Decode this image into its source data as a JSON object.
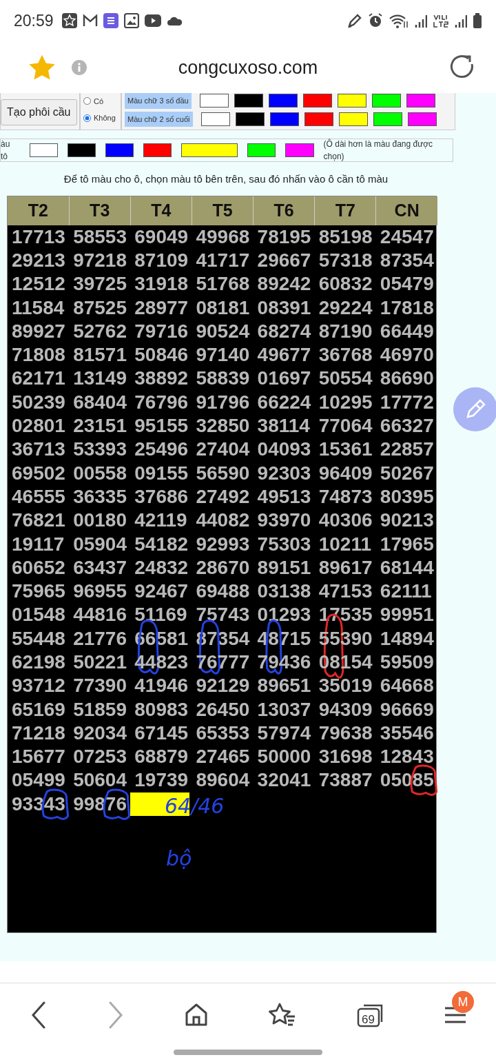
{
  "status_bar": {
    "time": "20:59"
  },
  "address_bar": {
    "url": "congcuxoso.com",
    "bookmarked": true
  },
  "options": {
    "button": "Tạo phôi cầu",
    "radios": [
      {
        "label": "Có",
        "selected": false
      },
      {
        "label": "Không",
        "selected": true
      }
    ]
  },
  "text_colors": [
    {
      "label": "Màu chữ 3 số đầu",
      "swatches": [
        {
          "color": "#ffffff"
        },
        {
          "color": "#000000"
        },
        {
          "color": "#0000ff"
        },
        {
          "color": "#ff0000"
        },
        {
          "color": "#ffff00"
        },
        {
          "color": "#00ff00"
        },
        {
          "color": "#ff00ff"
        }
      ]
    },
    {
      "label": "Màu chữ 2 số cuối",
      "swatches": [
        {
          "color": "#ffffff"
        },
        {
          "color": "#000000"
        },
        {
          "color": "#0000ff"
        },
        {
          "color": "#ff0000"
        },
        {
          "color": "#ffff00"
        },
        {
          "color": "#00ff00"
        },
        {
          "color": "#ff00ff"
        }
      ]
    }
  ],
  "fill_colors": {
    "label": "àu tô",
    "hint": "(Ô dài hơn là màu đang được chọn)",
    "swatches": [
      {
        "color": "#ffffff",
        "selected": false
      },
      {
        "color": "#000000",
        "selected": false
      },
      {
        "color": "#0000ff",
        "selected": false
      },
      {
        "color": "#ff0000",
        "selected": false
      },
      {
        "color": "#ffff00",
        "selected": true
      },
      {
        "color": "#00ff00",
        "selected": false
      },
      {
        "color": "#ff00ff",
        "selected": false
      }
    ]
  },
  "instruction": "Để tô màu cho ô, chọn màu tô bên trên, sau đó nhấn vào ô cần tô màu",
  "table": {
    "columns": [
      "T2",
      "T3",
      "T4",
      "T5",
      "T6",
      "T7",
      "CN"
    ],
    "rows": [
      [
        "17713",
        "58553",
        "69049",
        "49968",
        "78195",
        "85198",
        "24547"
      ],
      [
        "29213",
        "97218",
        "87109",
        "41717",
        "29667",
        "57318",
        "87354"
      ],
      [
        "12512",
        "39725",
        "31918",
        "51768",
        "89242",
        "60832",
        "05479"
      ],
      [
        "11584",
        "87525",
        "28977",
        "08181",
        "08391",
        "29224",
        "17818"
      ],
      [
        "89927",
        "52762",
        "79716",
        "90524",
        "68274",
        "87190",
        "66449"
      ],
      [
        "71808",
        "81571",
        "50846",
        "97140",
        "49677",
        "36768",
        "46970"
      ],
      [
        "62171",
        "13149",
        "38892",
        "58839",
        "01697",
        "50554",
        "86690"
      ],
      [
        "50239",
        "68404",
        "76796",
        "91796",
        "66224",
        "10295",
        "17772"
      ],
      [
        "02801",
        "23151",
        "95155",
        "32850",
        "38114",
        "77064",
        "66327"
      ],
      [
        "36713",
        "53393",
        "25496",
        "27404",
        "04093",
        "15361",
        "22857"
      ],
      [
        "69502",
        "00558",
        "09155",
        "56590",
        "92303",
        "96409",
        "50267"
      ],
      [
        "46555",
        "36335",
        "37686",
        "27492",
        "49513",
        "74873",
        "80395"
      ],
      [
        "76821",
        "00180",
        "42119",
        "44082",
        "93970",
        "40306",
        "90213"
      ],
      [
        "19117",
        "05904",
        "54182",
        "92993",
        "75303",
        "10211",
        "17965"
      ],
      [
        "60652",
        "63437",
        "24832",
        "28670",
        "89151",
        "89617",
        "68144"
      ],
      [
        "75965",
        "96955",
        "92467",
        "69488",
        "03138",
        "47153",
        "62111"
      ],
      [
        "01548",
        "44816",
        "51169",
        "75743",
        "01293",
        {
          "text": "17535",
          "loop": {
            "kind": "mid3",
            "color": "#e02626"
          }
        },
        "99951"
      ],
      [
        "55448",
        "21776",
        {
          "text": "66581",
          "loop": {
            "kind": "lead2",
            "color": "#2442e0"
          }
        },
        {
          "text": "87354",
          "loop": {
            "kind": "lead2",
            "color": "#2442e0"
          }
        },
        {
          "text": "48715",
          "loop": {
            "kind": "mid2",
            "color": "#2442e0"
          }
        },
        "55390",
        "14894"
      ],
      [
        "62198",
        "50221",
        "44823",
        "76777",
        "79436",
        "08154",
        "59509"
      ],
      [
        "93712",
        "77390",
        "41946",
        "92129",
        "89651",
        "35019",
        "64668"
      ],
      [
        "65169",
        "51859",
        "80983",
        "26450",
        "13037",
        "94309",
        "96669"
      ],
      [
        "71218",
        "92034",
        "67145",
        "65353",
        "57974",
        "79638",
        "35546"
      ],
      [
        "15677",
        "07253",
        "68879",
        "27465",
        "50000",
        "31698",
        "12843"
      ],
      [
        "05499",
        "50604",
        "19739",
        "89604",
        "32041",
        "73887",
        {
          "text": "05085",
          "loop": {
            "kind": "tail",
            "color": "#e02626"
          }
        }
      ],
      [
        {
          "text": "93343",
          "loop": {
            "kind": "tail",
            "color": "#2442e0"
          }
        },
        {
          "text": "99876",
          "loop": {
            "kind": "tail",
            "color": "#2442e0"
          }
        },
        {
          "kind": "filled",
          "color": "#ffff00"
        }
      ]
    ]
  },
  "annotations": [
    {
      "text": "64/46",
      "kind": "ratio",
      "color": "#2442e0"
    },
    {
      "text": "bộ",
      "kind": "word",
      "color": "#2442e0"
    }
  ],
  "bottom_nav": {
    "forward_disabled": true,
    "tab_count": "69",
    "badge": "M"
  }
}
